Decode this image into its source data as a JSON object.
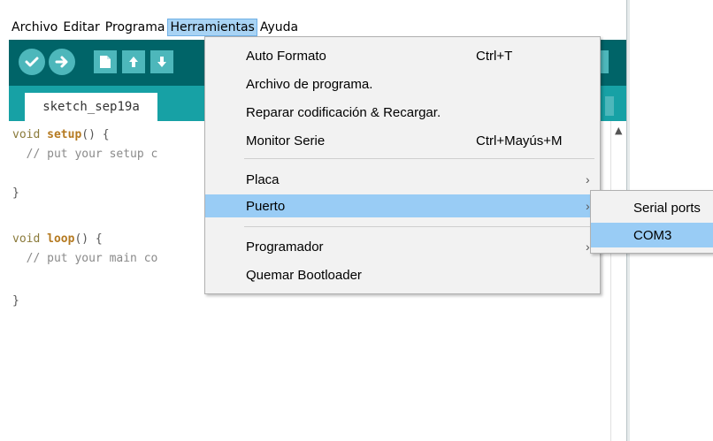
{
  "menubar": {
    "items": [
      "Archivo",
      "Editar",
      "Programa",
      "Herramientas",
      "Ayuda"
    ],
    "active": "Herramientas"
  },
  "tab": {
    "name": "sketch_sep19a"
  },
  "code": {
    "lines": [
      {
        "kw": "void",
        "fn": "setup",
        "rest": "() {"
      },
      {
        "comment": "  // put your setup c"
      },
      {
        "text": ""
      },
      {
        "text": "}"
      },
      {
        "text": ""
      },
      {
        "kw": "void",
        "fn": "loop",
        "rest": "() {"
      },
      {
        "comment": "  // put your main co"
      },
      {
        "text": ""
      },
      {
        "text": "}"
      }
    ]
  },
  "tools_menu": {
    "auto_format": {
      "label": "Auto Formato",
      "shortcut": "Ctrl+T"
    },
    "archive_sketch": {
      "label": "Archivo de programa."
    },
    "fix_encoding": {
      "label": "Reparar codificación & Recargar."
    },
    "serial_monitor": {
      "label": "Monitor Serie",
      "shortcut": "Ctrl+Mayús+M"
    },
    "board": {
      "label": "Placa"
    },
    "port": {
      "label": "Puerto"
    },
    "programmer": {
      "label": "Programador"
    },
    "burn_bootloader": {
      "label": "Quemar Bootloader"
    }
  },
  "port_submenu": {
    "header": "Serial ports",
    "items": [
      "COM3"
    ]
  },
  "colors": {
    "toolbar": "#006468",
    "tabbar": "#17a1a5",
    "button": "#4db7bb",
    "highlight": "#99ccf5"
  },
  "icons": {
    "verify": "check-icon",
    "upload": "arrow-right-icon",
    "new": "new-file-icon",
    "open": "arrow-up-icon",
    "save": "arrow-down-icon",
    "submenu": "chevron-right-icon",
    "scroll": "chevron-up-icon"
  }
}
